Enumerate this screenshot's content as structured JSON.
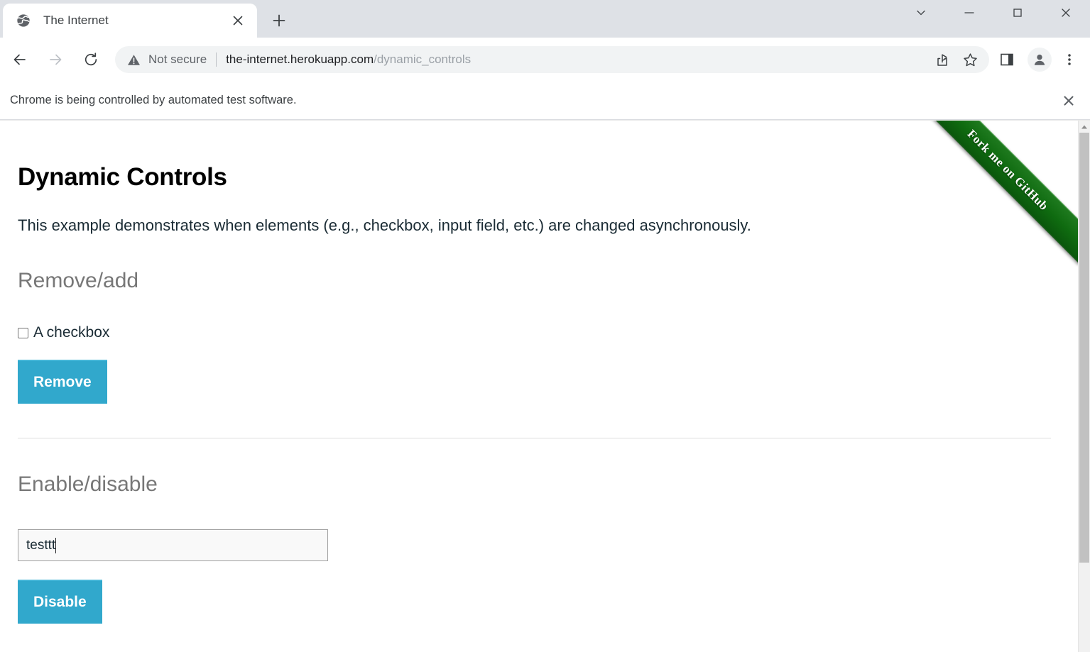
{
  "window": {
    "controls": [
      {
        "name": "tab-search",
        "glyph": "chevron-down"
      },
      {
        "name": "minimize",
        "glyph": "minus"
      },
      {
        "name": "maximize",
        "glyph": "square"
      },
      {
        "name": "close",
        "glyph": "x"
      }
    ]
  },
  "tabs": [
    {
      "title": "The Internet",
      "favicon": "globe-icon",
      "close_label": "×",
      "active": true
    }
  ],
  "newtab": {
    "label": "+"
  },
  "toolbar": {
    "back_label": "←",
    "forward_label": "→",
    "reload_label": "⟳",
    "security": {
      "icon": "warning-triangle-icon",
      "text": "Not secure"
    },
    "url": {
      "host": "the-internet.herokuapp.com",
      "path": "/dynamic_controls",
      "full": "the-internet.herokuapp.com/dynamic_controls"
    },
    "icons": [
      {
        "name": "share-icon"
      },
      {
        "name": "bookmark-star-icon"
      },
      {
        "name": "side-panel-icon"
      },
      {
        "name": "profile-avatar-icon"
      },
      {
        "name": "three-dot-menu-icon"
      }
    ]
  },
  "infobar": {
    "message": "Chrome is being controlled by automated test software.",
    "close_label": "×"
  },
  "page": {
    "title": "Dynamic Controls",
    "lede": "This example demonstrates when elements (e.g., checkbox, input field, etc.) are changed asynchronously.",
    "sections": [
      {
        "heading": "Remove/add",
        "checkbox_label": "A checkbox",
        "checkbox_checked": false,
        "button_label": "Remove"
      },
      {
        "heading": "Enable/disable",
        "input_value": "testtt",
        "input_placeholder": "",
        "button_label": "Disable"
      }
    ],
    "ribbon": "Fork me on GitHub"
  },
  "colors": {
    "button_teal": "#31a8cc",
    "ribbon_green": "#0f6b10",
    "heading_gray": "#777777"
  },
  "scrollbar": {
    "arrow_up": "▲"
  }
}
